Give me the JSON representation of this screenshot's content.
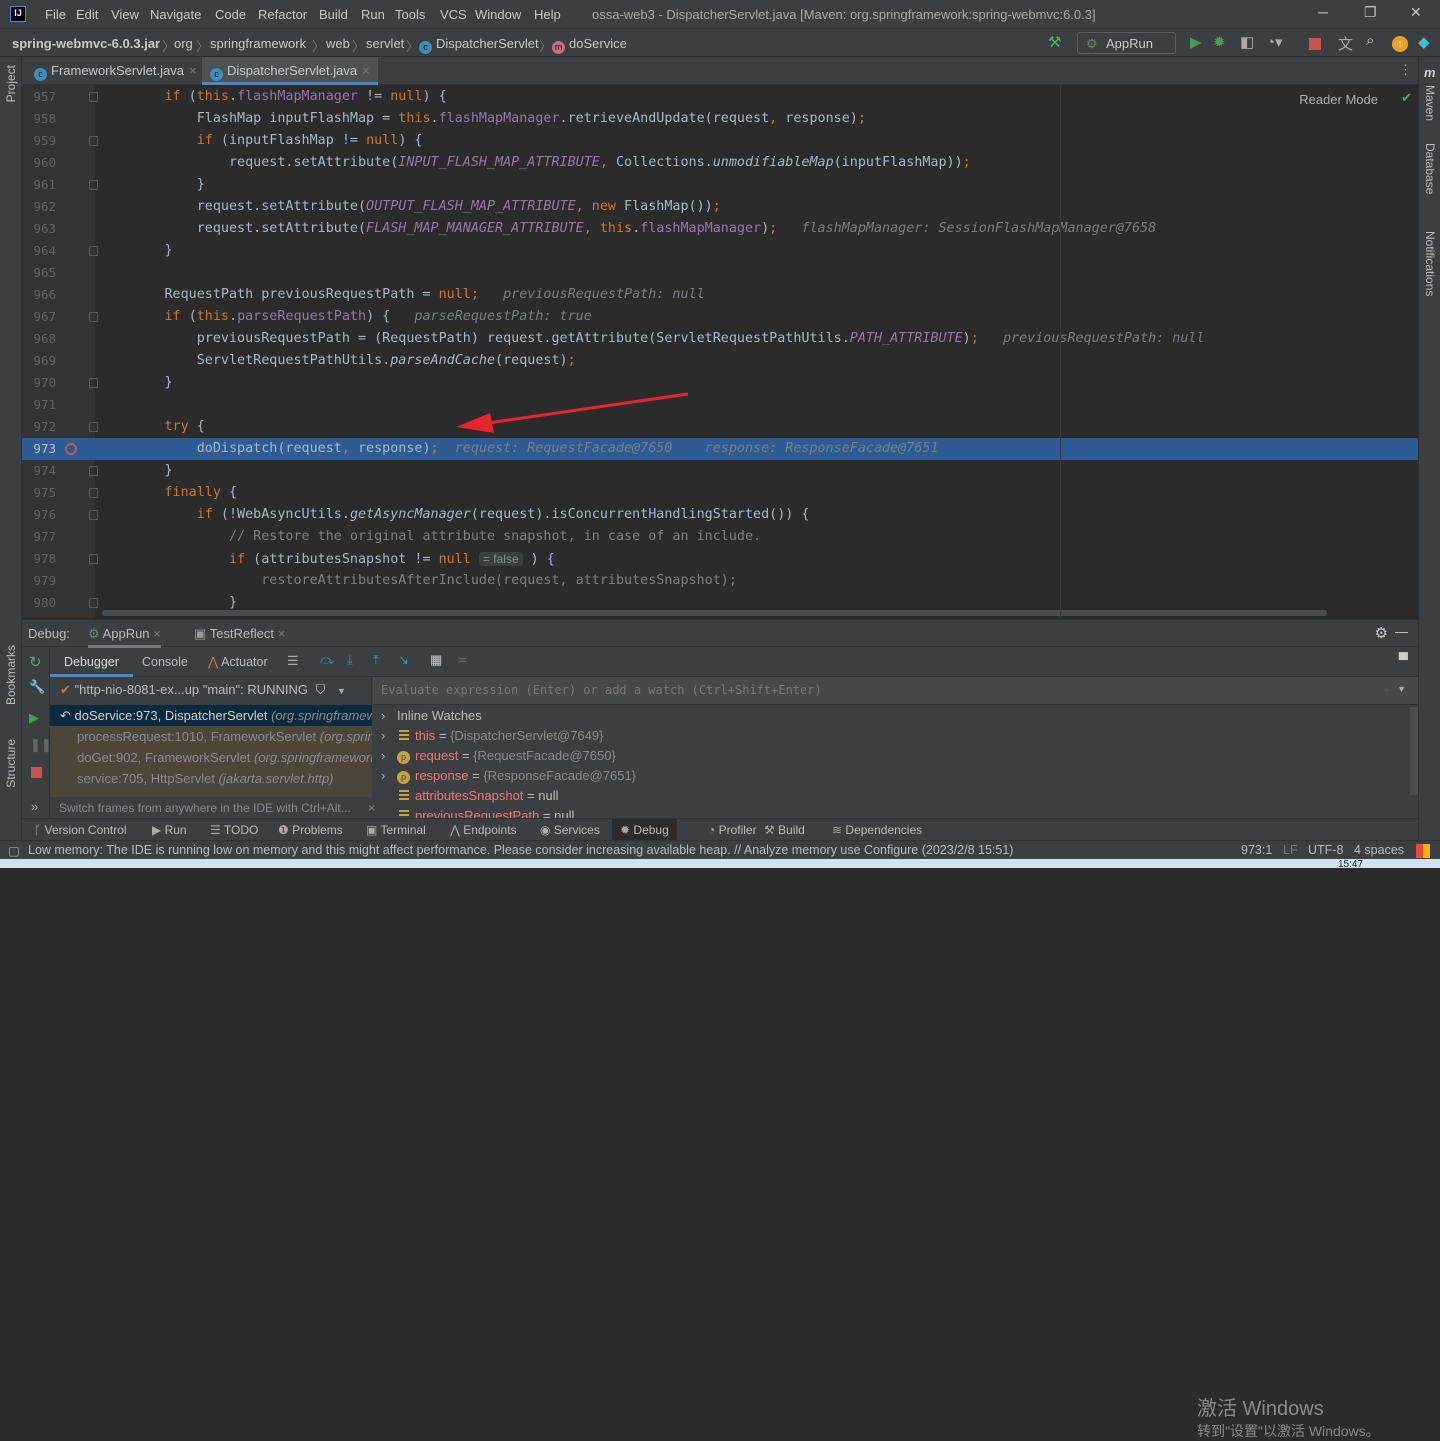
{
  "menubar": {
    "logo": "IJ",
    "items": [
      "File",
      "Edit",
      "View",
      "Navigate",
      "Code",
      "Refactor",
      "Build",
      "Run",
      "Tools",
      "VCS",
      "Window",
      "Help"
    ],
    "title": "ossa-web3 - DispatcherServlet.java [Maven: org.springframework:spring-webmvc:6.0.3]",
    "minimize": "─",
    "restore": "❐",
    "close": "✕"
  },
  "navbar": {
    "crumbs": [
      "spring-webmvc-6.0.3.jar",
      "org",
      "springframework",
      "web",
      "servlet",
      "DispatcherServlet",
      "doService"
    ],
    "run_config": "AppRun"
  },
  "tabs": [
    {
      "label": "FrameworkServlet.java",
      "active": false
    },
    {
      "label": "DispatcherServlet.java",
      "active": true
    }
  ],
  "left_strip": {
    "project": "Project",
    "bookmarks": "Bookmarks",
    "structure": "Structure"
  },
  "right_strip": {
    "maven": "Maven",
    "database": "Database",
    "notifications": "Notifications"
  },
  "editor": {
    "reader_mode": "Reader Mode",
    "current_line": 973,
    "lines": [
      {
        "n": 957,
        "fold": true,
        "t": [
          [
            "p",
            "        "
          ],
          [
            "kw",
            "if"
          ],
          [
            "p",
            " ("
          ],
          [
            "kw",
            "this"
          ],
          [
            "p",
            "."
          ],
          [
            "field",
            "flashMapManager"
          ],
          [
            "p",
            " != "
          ],
          [
            "kw",
            "null"
          ],
          [
            "p",
            ") {"
          ]
        ]
      },
      {
        "n": 958,
        "fold": false,
        "t": [
          [
            "p",
            "            FlashMap inputFlashMap = "
          ],
          [
            "kw",
            "this"
          ],
          [
            "p",
            "."
          ],
          [
            "field",
            "flashMapManager"
          ],
          [
            "p",
            ".retrieveAndUpdate(request"
          ],
          [
            "kw",
            ","
          ],
          [
            "p",
            " response)"
          ],
          [
            "kw",
            ";"
          ]
        ]
      },
      {
        "n": 959,
        "fold": true,
        "t": [
          [
            "p",
            "            "
          ],
          [
            "kw",
            "if"
          ],
          [
            "p",
            " (inputFlashMap != "
          ],
          [
            "kw",
            "null"
          ],
          [
            "p",
            ") {"
          ]
        ]
      },
      {
        "n": 960,
        "fold": false,
        "t": [
          [
            "p",
            "                request.setAttribute("
          ],
          [
            "const",
            "INPUT_FLASH_MAP_ATTRIBUTE"
          ],
          [
            "kw",
            ","
          ],
          [
            "p",
            " Collections."
          ],
          [
            "static",
            "unmodifiableMap"
          ],
          [
            "p",
            "(inputFlashMap))"
          ],
          [
            "kw",
            ";"
          ]
        ]
      },
      {
        "n": 961,
        "fold": true,
        "t": [
          [
            "p",
            "            }"
          ]
        ]
      },
      {
        "n": 962,
        "fold": false,
        "t": [
          [
            "p",
            "            request.setAttribute("
          ],
          [
            "const",
            "OUTPUT_FLASH_MAP_ATTRIBUTE"
          ],
          [
            "kw",
            ","
          ],
          [
            "p",
            " "
          ],
          [
            "kw",
            "new"
          ],
          [
            "p",
            " FlashMap())"
          ],
          [
            "kw",
            ";"
          ]
        ]
      },
      {
        "n": 963,
        "fold": false,
        "t": [
          [
            "p",
            "            request.setAttribute("
          ],
          [
            "const",
            "FLASH_MAP_MANAGER_ATTRIBUTE"
          ],
          [
            "kw",
            ","
          ],
          [
            "p",
            " "
          ],
          [
            "kw",
            "this"
          ],
          [
            "p",
            "."
          ],
          [
            "field",
            "flashMapManager"
          ],
          [
            "p",
            ")"
          ],
          [
            "kw",
            ";"
          ],
          [
            "p",
            "   "
          ],
          [
            "hint",
            "flashMapManager: SessionFlashMapManager@7658"
          ]
        ]
      },
      {
        "n": 964,
        "fold": true,
        "t": [
          [
            "p",
            "        }"
          ]
        ]
      },
      {
        "n": 965,
        "fold": false,
        "t": []
      },
      {
        "n": 966,
        "fold": false,
        "t": [
          [
            "p",
            "        RequestPath previousRequestPath = "
          ],
          [
            "kw",
            "null"
          ],
          [
            "kw",
            ";"
          ],
          [
            "p",
            "   "
          ],
          [
            "hint",
            "previousRequestPath: null"
          ]
        ]
      },
      {
        "n": 967,
        "fold": true,
        "t": [
          [
            "p",
            "        "
          ],
          [
            "kw",
            "if"
          ],
          [
            "p",
            " ("
          ],
          [
            "kw",
            "this"
          ],
          [
            "p",
            "."
          ],
          [
            "field",
            "parseRequestPath"
          ],
          [
            "p",
            ") {   "
          ],
          [
            "hint",
            "parseRequestPath: true"
          ]
        ]
      },
      {
        "n": 968,
        "fold": false,
        "t": [
          [
            "p",
            "            previousRequestPath = (RequestPath) request.getAttribute(ServletRequestPathUtils."
          ],
          [
            "const",
            "PATH_ATTRIBUTE"
          ],
          [
            "p",
            ")"
          ],
          [
            "kw",
            ";"
          ],
          [
            "p",
            "   "
          ],
          [
            "hint",
            "previousRequestPath: null"
          ]
        ]
      },
      {
        "n": 969,
        "fold": false,
        "t": [
          [
            "p",
            "            ServletRequestPathUtils."
          ],
          [
            "static",
            "parseAndCache"
          ],
          [
            "p",
            "(request)"
          ],
          [
            "kw",
            ";"
          ]
        ]
      },
      {
        "n": 970,
        "fold": true,
        "t": [
          [
            "p",
            "        }"
          ]
        ]
      },
      {
        "n": 971,
        "fold": false,
        "t": []
      },
      {
        "n": 972,
        "fold": true,
        "t": [
          [
            "p",
            "        "
          ],
          [
            "kw",
            "try"
          ],
          [
            "p",
            " {"
          ]
        ]
      },
      {
        "n": 973,
        "fold": false,
        "t": [
          [
            "p",
            "            doDispatch(request"
          ],
          [
            "kw",
            ","
          ],
          [
            "p",
            " response)"
          ],
          [
            "kw",
            ";"
          ],
          [
            "p",
            "  "
          ],
          [
            "hint",
            "request: RequestFacade@7650    response: ResponseFacade@7651"
          ]
        ]
      },
      {
        "n": 974,
        "fold": true,
        "t": [
          [
            "p",
            "        }"
          ]
        ]
      },
      {
        "n": 975,
        "fold": true,
        "t": [
          [
            "p",
            "        "
          ],
          [
            "kw",
            "finally"
          ],
          [
            "p",
            " {"
          ]
        ]
      },
      {
        "n": 976,
        "fold": true,
        "t": [
          [
            "p",
            "            "
          ],
          [
            "kw",
            "if"
          ],
          [
            "p",
            " (!WebAsyncUtils."
          ],
          [
            "static",
            "getAsyncManager"
          ],
          [
            "p",
            "(request).isConcurrentHandlingStarted()) {"
          ]
        ]
      },
      {
        "n": 977,
        "fold": false,
        "t": [
          [
            "cmt",
            "                // Restore the original attribute snapshot, in case of an include."
          ]
        ]
      },
      {
        "n": 978,
        "fold": true,
        "t": [
          [
            "p",
            "                "
          ],
          [
            "kw",
            "if"
          ],
          [
            "p",
            " (attributesSnapshot != "
          ],
          [
            "kw",
            "null"
          ],
          [
            "p",
            " "
          ],
          [
            "inlay",
            "= false"
          ],
          [
            "p",
            " ) {"
          ]
        ]
      },
      {
        "n": 979,
        "fold": false,
        "t": [
          [
            "cmt",
            "                    restoreAttributesAfterInclude(request, attributesSnapshot);"
          ]
        ]
      },
      {
        "n": 980,
        "fold": true,
        "t": [
          [
            "p",
            "                }"
          ]
        ]
      }
    ]
  },
  "debug": {
    "label": "Debug:",
    "sessions": [
      {
        "label": "AppRun"
      },
      {
        "label": "TestReflect"
      }
    ],
    "tabs": [
      "Debugger",
      "Console",
      "Actuator"
    ],
    "thread": "\"http-nio-8081-ex...up \"main\": RUNNING",
    "frames": [
      {
        "method": "doService:973, DispatcherServlet",
        "pkg": "(org.springframework.web.servlet)"
      },
      {
        "method": "processRequest:1010, FrameworkServlet",
        "pkg": "(org.springframework.web.servlet)"
      },
      {
        "method": "doGet:902, FrameworkServlet",
        "pkg": "(org.springframework.web.servlet)"
      },
      {
        "method": "service:705, HttpServlet",
        "pkg": "(jakarta.servlet.http)"
      }
    ],
    "frames_hint": "Switch frames from anywhere in the IDE with Ctrl+Alt...",
    "eval_placeholder": "Evaluate expression (Enter) or add a watch (Ctrl+Shift+Enter)",
    "variables": [
      {
        "name": "Inline Watches",
        "value": "",
        "icon": "none",
        "expandable": true
      },
      {
        "name": "this",
        "value": "{DispatcherServlet@7649}",
        "icon": "field",
        "expandable": true
      },
      {
        "name": "request",
        "value": "{RequestFacade@7650}",
        "icon": "param",
        "expandable": true
      },
      {
        "name": "response",
        "value": "{ResponseFacade@7651}",
        "icon": "param",
        "expandable": true
      },
      {
        "name": "attributesSnapshot",
        "value": "null",
        "icon": "field",
        "expandable": false
      },
      {
        "name": "previousRequestPath",
        "value": "null",
        "icon": "field",
        "expandable": false
      }
    ]
  },
  "watermark": {
    "line1": "激活 Windows",
    "line2": "转到\"设置\"以激活 Windows。"
  },
  "toolwindows": [
    "Version Control",
    "Run",
    "TODO",
    "Problems",
    "Terminal",
    "Endpoints",
    "Services",
    "Debug",
    "Profiler",
    "Build",
    "Dependencies"
  ],
  "toolwindow_active": "Debug",
  "status": {
    "message": "Low memory: The IDE is running low on memory and this might affect performance. Please consider increasing available heap. // Analyze memory use   Configure (2023/2/8 15:51)",
    "position": "973:1",
    "line_sep": "LF",
    "encoding": "UTF-8",
    "indent": "4 spaces"
  },
  "taskbar": {
    "clock": "15:47"
  },
  "colors": {
    "accent": "#2d5c94",
    "keyword": "#cc7832",
    "field": "#9876aa",
    "breakpoint": "#c75450",
    "arrow": "#e8252a"
  }
}
